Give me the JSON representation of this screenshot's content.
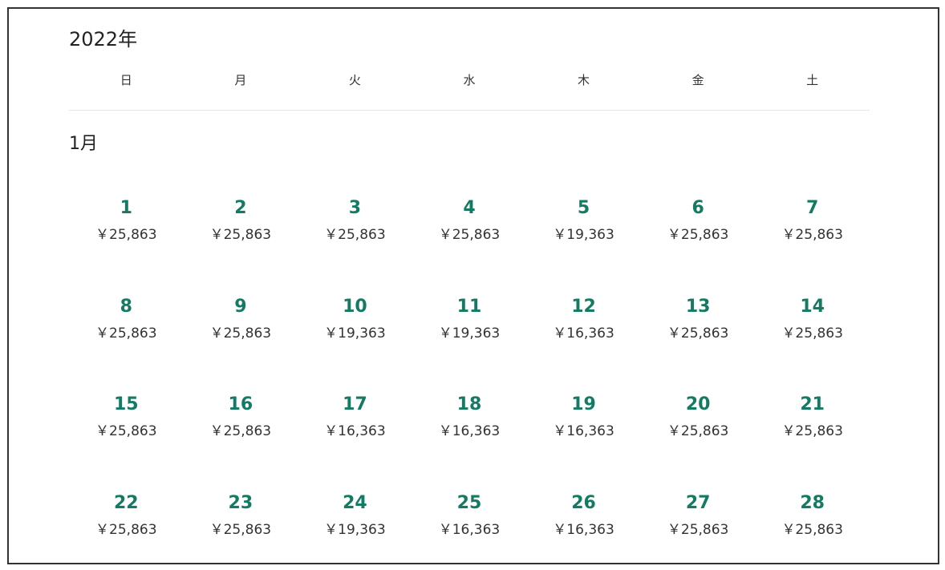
{
  "calendar": {
    "year_label": "2022年",
    "month_label": "1月",
    "weekdays": [
      "日",
      "月",
      "火",
      "水",
      "木",
      "金",
      "土"
    ],
    "days": [
      {
        "day": "1",
        "price": "￥25,863"
      },
      {
        "day": "2",
        "price": "￥25,863"
      },
      {
        "day": "3",
        "price": "￥25,863"
      },
      {
        "day": "4",
        "price": "￥25,863"
      },
      {
        "day": "5",
        "price": "￥19,363"
      },
      {
        "day": "6",
        "price": "￥25,863"
      },
      {
        "day": "7",
        "price": "￥25,863"
      },
      {
        "day": "8",
        "price": "￥25,863"
      },
      {
        "day": "9",
        "price": "￥25,863"
      },
      {
        "day": "10",
        "price": "￥19,363"
      },
      {
        "day": "11",
        "price": "￥19,363"
      },
      {
        "day": "12",
        "price": "￥16,363"
      },
      {
        "day": "13",
        "price": "￥25,863"
      },
      {
        "day": "14",
        "price": "￥25,863"
      },
      {
        "day": "15",
        "price": "￥25,863"
      },
      {
        "day": "16",
        "price": "￥25,863"
      },
      {
        "day": "17",
        "price": "￥16,363"
      },
      {
        "day": "18",
        "price": "￥16,363"
      },
      {
        "day": "19",
        "price": "￥16,363"
      },
      {
        "day": "20",
        "price": "￥25,863"
      },
      {
        "day": "21",
        "price": "￥25,863"
      },
      {
        "day": "22",
        "price": "￥25,863"
      },
      {
        "day": "23",
        "price": "￥25,863"
      },
      {
        "day": "24",
        "price": "￥19,363"
      },
      {
        "day": "25",
        "price": "￥16,363"
      },
      {
        "day": "26",
        "price": "￥16,363"
      },
      {
        "day": "27",
        "price": "￥25,863"
      },
      {
        "day": "28",
        "price": "￥25,863"
      }
    ]
  },
  "colors": {
    "day_number": "#147a63",
    "price_text": "#333333",
    "border": "#333333",
    "divider": "#e6e6e6"
  }
}
